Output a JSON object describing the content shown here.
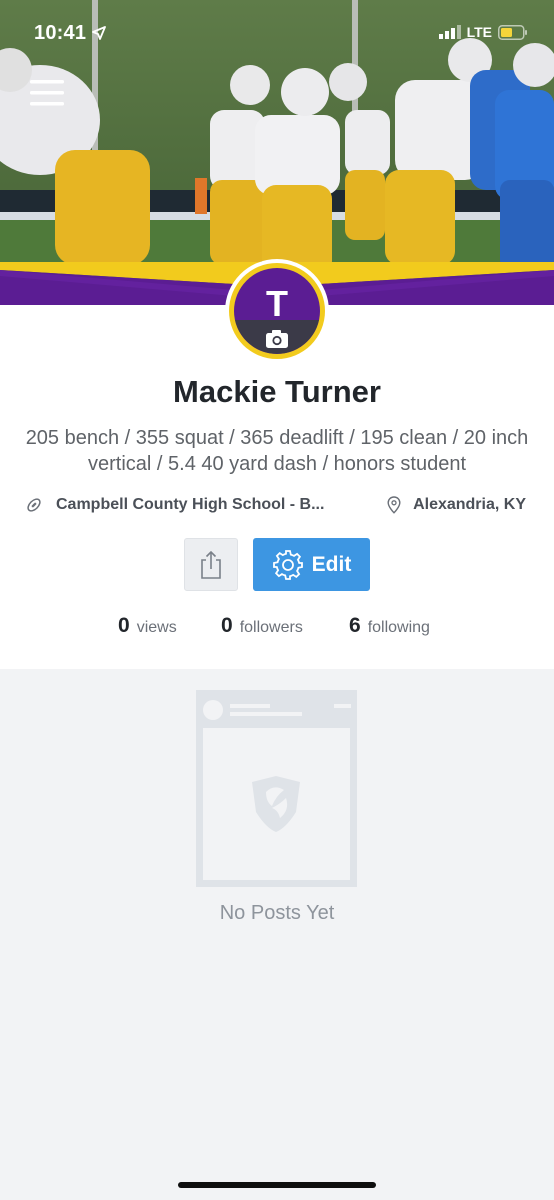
{
  "status_bar": {
    "time": "10:41",
    "network": "LTE"
  },
  "profile": {
    "avatar_initial": "T",
    "name": "Mackie Turner",
    "bio": "205 bench / 355 squat / 365 deadlift / 195 clean / 20 inch vertical / 5.4 40 yard dash / honors student",
    "school": "Campbell County High School - B...",
    "location": "Alexandria, KY"
  },
  "actions": {
    "edit_label": "Edit"
  },
  "stats": [
    {
      "value": "0",
      "label": "views"
    },
    {
      "value": "0",
      "label": "followers"
    },
    {
      "value": "6",
      "label": "following"
    }
  ],
  "feed": {
    "empty_label": "No Posts Yet"
  },
  "icons": {
    "menu": "hamburger-menu-icon",
    "location_arrow": "location-arrow-icon",
    "signal": "signal-bars-icon",
    "battery": "battery-icon",
    "camera": "camera-icon",
    "football": "football-icon",
    "map_pin": "map-pin-icon",
    "share": "share-icon",
    "gear": "gear-icon"
  },
  "colors": {
    "banner_purple": "#5b1d93",
    "banner_gold": "#f2cb1d",
    "edit_button": "#3d96e2",
    "background": "#f2f3f5"
  }
}
